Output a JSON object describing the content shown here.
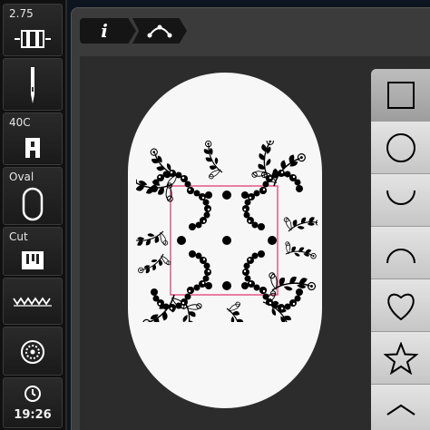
{
  "sidebar": {
    "stitch_width": "2.75",
    "presser_foot": "40C",
    "hoop": "Oval",
    "cut_label": "Cut",
    "time": "19:26"
  },
  "toolbar": {
    "info_icon": "info-icon",
    "curve_icon": "curve-points-icon"
  },
  "palette": {
    "shapes": [
      "square",
      "circle",
      "arc-down",
      "arc-up",
      "heart",
      "star",
      "more"
    ],
    "selected": "square"
  },
  "colors": {
    "background": "#0d1620",
    "panel": "#3b3b3b",
    "hoop": "#f7f7f7",
    "frame_line": "#e0306a"
  }
}
